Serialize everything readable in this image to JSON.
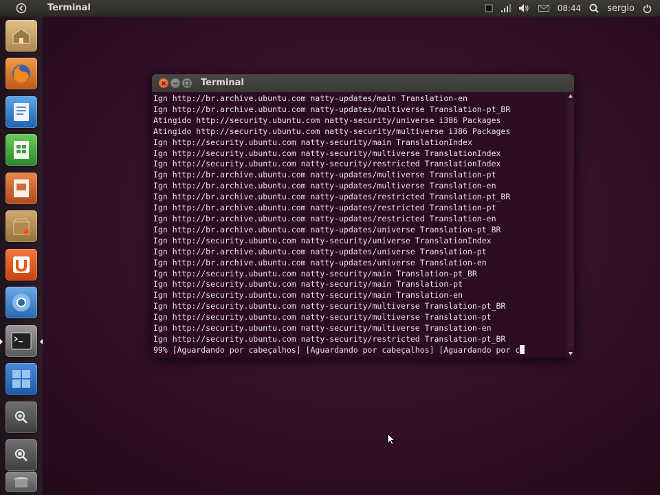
{
  "top_panel": {
    "app_title": "Terminal",
    "clock": "08:44",
    "user": "sergio"
  },
  "launcher": {
    "items": [
      {
        "name": "home-folder",
        "color": "#c9a46a"
      },
      {
        "name": "firefox",
        "color": "#e0782a"
      },
      {
        "name": "libreoffice-writer",
        "color": "#2f7fc8"
      },
      {
        "name": "libreoffice-calc",
        "color": "#3a9a3a"
      },
      {
        "name": "libreoffice-impress",
        "color": "#c85a2a"
      },
      {
        "name": "ubuntu-software-center",
        "color": "#b08a55"
      },
      {
        "name": "ubuntu-one",
        "color": "#e05a1e"
      },
      {
        "name": "chromium",
        "color": "#3a78c0"
      },
      {
        "name": "terminal",
        "color": "#555555"
      },
      {
        "name": "workspace-switcher",
        "color": "#2a66b8"
      },
      {
        "name": "dash-search-apps",
        "color": "#5a5a5a"
      },
      {
        "name": "dash-search-files",
        "color": "#5a5a5a"
      },
      {
        "name": "trash",
        "color": "#6a6a6a"
      }
    ]
  },
  "terminal": {
    "title": "Terminal",
    "lines": [
      "Ign http://br.archive.ubuntu.com natty-updates/main Translation-en",
      "Ign http://br.archive.ubuntu.com natty-updates/multiverse Translation-pt_BR",
      "Atingido http://security.ubuntu.com natty-security/universe i386 Packages",
      "Atingido http://security.ubuntu.com natty-security/multiverse i386 Packages",
      "Ign http://security.ubuntu.com natty-security/main TranslationIndex",
      "Ign http://security.ubuntu.com natty-security/multiverse TranslationIndex",
      "Ign http://security.ubuntu.com natty-security/restricted TranslationIndex",
      "Ign http://br.archive.ubuntu.com natty-updates/multiverse Translation-pt",
      "Ign http://br.archive.ubuntu.com natty-updates/multiverse Translation-en",
      "Ign http://br.archive.ubuntu.com natty-updates/restricted Translation-pt_BR",
      "Ign http://br.archive.ubuntu.com natty-updates/restricted Translation-pt",
      "Ign http://br.archive.ubuntu.com natty-updates/restricted Translation-en",
      "Ign http://br.archive.ubuntu.com natty-updates/universe Translation-pt_BR",
      "Ign http://security.ubuntu.com natty-security/universe TranslationIndex",
      "Ign http://br.archive.ubuntu.com natty-updates/universe Translation-pt",
      "Ign http://br.archive.ubuntu.com natty-updates/universe Translation-en",
      "Ign http://security.ubuntu.com natty-security/main Translation-pt_BR",
      "Ign http://security.ubuntu.com natty-security/main Translation-pt",
      "Ign http://security.ubuntu.com natty-security/main Translation-en",
      "Ign http://security.ubuntu.com natty-security/multiverse Translation-pt_BR",
      "Ign http://security.ubuntu.com natty-security/multiverse Translation-pt",
      "Ign http://security.ubuntu.com natty-security/multiverse Translation-en",
      "Ign http://security.ubuntu.com natty-security/restricted Translation-pt_BR",
      "99% [Aguardando por cabeçalhos] [Aguardando por cabeçalhos] [Aguardando por c"
    ]
  },
  "colors": {
    "desktop": "#34102a",
    "terminal_bg": "#2c0c24",
    "close_button": "#e0582a"
  }
}
